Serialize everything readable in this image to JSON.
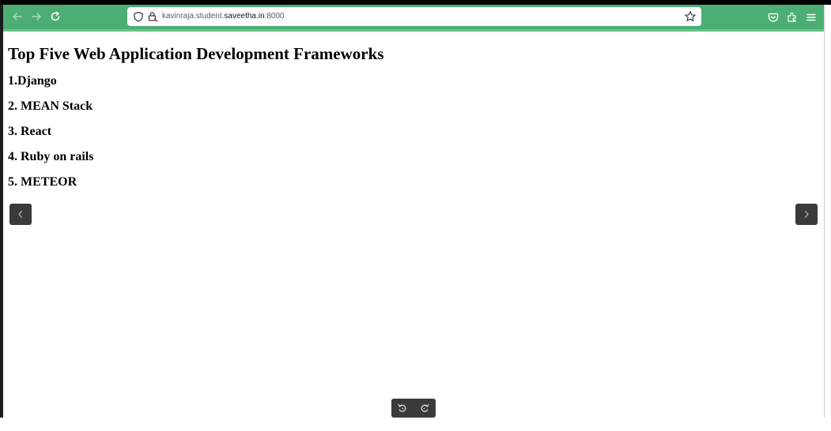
{
  "browser": {
    "url_host_prefix": "kavinraja.student.",
    "url_host_domain": "saveetha.in",
    "url_port": ":8000",
    "colors": {
      "toolbar": "#4cae72",
      "toolbar_accent": "#67c48a",
      "urlbar": "#ffffff"
    },
    "icons": {
      "back": "arrow-left-icon",
      "forward": "arrow-right-icon",
      "reload": "reload-icon",
      "tracking": "shield-icon",
      "security": "lock-icon",
      "bookmark": "star-icon",
      "pocket": "pocket-icon",
      "extensions": "extensions-icon",
      "menu": "hamburger-menu-icon"
    }
  },
  "page": {
    "title": "Top Five Web Application Development Frameworks",
    "frameworks": [
      "1.Django",
      "2. MEAN Stack",
      "3. React",
      "4. Ruby on rails",
      "5. METEOR"
    ]
  },
  "viewer": {
    "prev_icon": "chevron-left-icon",
    "next_icon": "chevron-right-icon",
    "rotate_left_icon": "rotate-left-icon",
    "rotate_right_icon": "rotate-right-icon",
    "control_color": "#3a3a3a"
  }
}
